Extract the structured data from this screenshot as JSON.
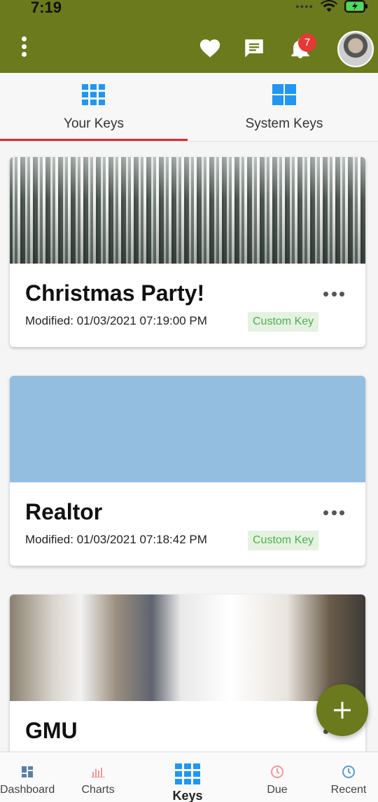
{
  "status_bar": {
    "time": "7:19"
  },
  "header": {
    "notification_count": "7"
  },
  "tabs": [
    {
      "label": "Your Keys",
      "active": true
    },
    {
      "label": "System Keys",
      "active": false
    }
  ],
  "cards": [
    {
      "title": "Christmas Party!",
      "modified": "Modified: 01/03/2021 07:19:00 PM",
      "badge": "Custom Key",
      "image": "snowy-forest"
    },
    {
      "title": "Realtor",
      "modified": "Modified: 01/03/2021 07:18:42 PM",
      "badge": "Custom Key",
      "image": "solid-blue"
    },
    {
      "title": "GMU",
      "image": "chef-kitchen"
    }
  ],
  "bottom_nav": [
    {
      "label": "Dashboard",
      "icon": "dashboard-icon"
    },
    {
      "label": "Charts",
      "icon": "bar-chart-icon"
    },
    {
      "label": "Keys",
      "icon": "grid-icon",
      "active": true
    },
    {
      "label": "Due",
      "icon": "clock-icon"
    },
    {
      "label": "Recent",
      "icon": "clock-icon"
    }
  ],
  "colors": {
    "header": "#6a7a1c",
    "accent_blue": "#2196f3",
    "active_tab": "#d32f2f",
    "badge_green": "#4caf50"
  }
}
